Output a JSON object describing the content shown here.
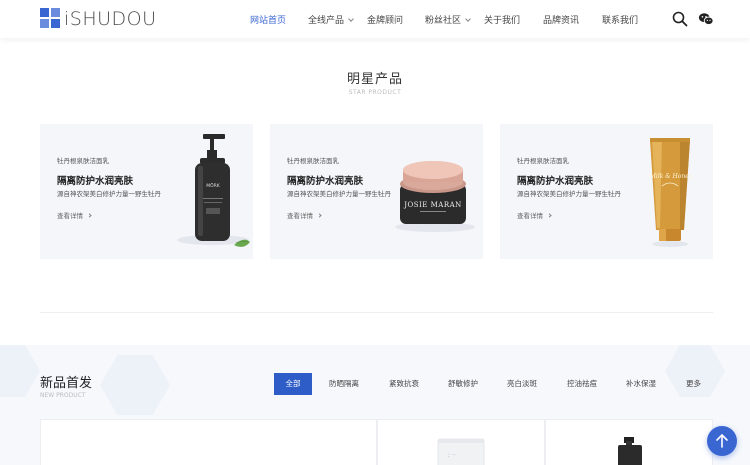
{
  "brand": {
    "logo_text": "iSHUDOU",
    "accent": "#3a66d2"
  },
  "nav": {
    "items": [
      {
        "label": "网站首页",
        "active": true,
        "dropdown": false
      },
      {
        "label": "全线产品",
        "active": false,
        "dropdown": true
      },
      {
        "label": "金牌顾问",
        "active": false,
        "dropdown": false
      },
      {
        "label": "粉丝社区",
        "active": false,
        "dropdown": true
      },
      {
        "label": "关于我们",
        "active": false,
        "dropdown": false
      },
      {
        "label": "品牌资讯",
        "active": false,
        "dropdown": false
      },
      {
        "label": "联系我们",
        "active": false,
        "dropdown": false
      }
    ],
    "icons": [
      "search-icon",
      "wechat-icon"
    ]
  },
  "star": {
    "title": "明星产品",
    "subtitle": "STAR PRODUCT",
    "cards": [
      {
        "small": "牡丹根泉肤洁面乳",
        "title": "隔离防护水润亮肤",
        "desc": "源自神农架美白修护力量一野生牡丹",
        "more": "查看详情",
        "product": "pump-bottle",
        "label": "MÖRK"
      },
      {
        "small": "牡丹根泉肤洁面乳",
        "title": "隔离防护水润亮肤",
        "desc": "源自神农架美白修护力量一野生牡丹",
        "more": "查看详情",
        "product": "cream-jar",
        "label": "JOSIE MARAN"
      },
      {
        "small": "牡丹根泉肤洁面乳",
        "title": "隔离防护水润亮肤",
        "desc": "源自神农架美白修护力量一野生牡丹",
        "more": "查看详情",
        "product": "tube",
        "label": "Milk & Honey"
      }
    ]
  },
  "new_products": {
    "title": "新品首发",
    "subtitle": "NEW PRODUCT",
    "tabs": [
      {
        "label": "全部",
        "active": true
      },
      {
        "label": "防晒隔离",
        "active": false
      },
      {
        "label": "紧致抗衰",
        "active": false
      },
      {
        "label": "舒敏修护",
        "active": false
      },
      {
        "label": "亮白淡斑",
        "active": false
      },
      {
        "label": "控油祛痘",
        "active": false
      },
      {
        "label": "补水保湿",
        "active": false
      },
      {
        "label": "更多",
        "active": false
      }
    ]
  },
  "fab": {
    "icon": "arrow-up-icon"
  }
}
